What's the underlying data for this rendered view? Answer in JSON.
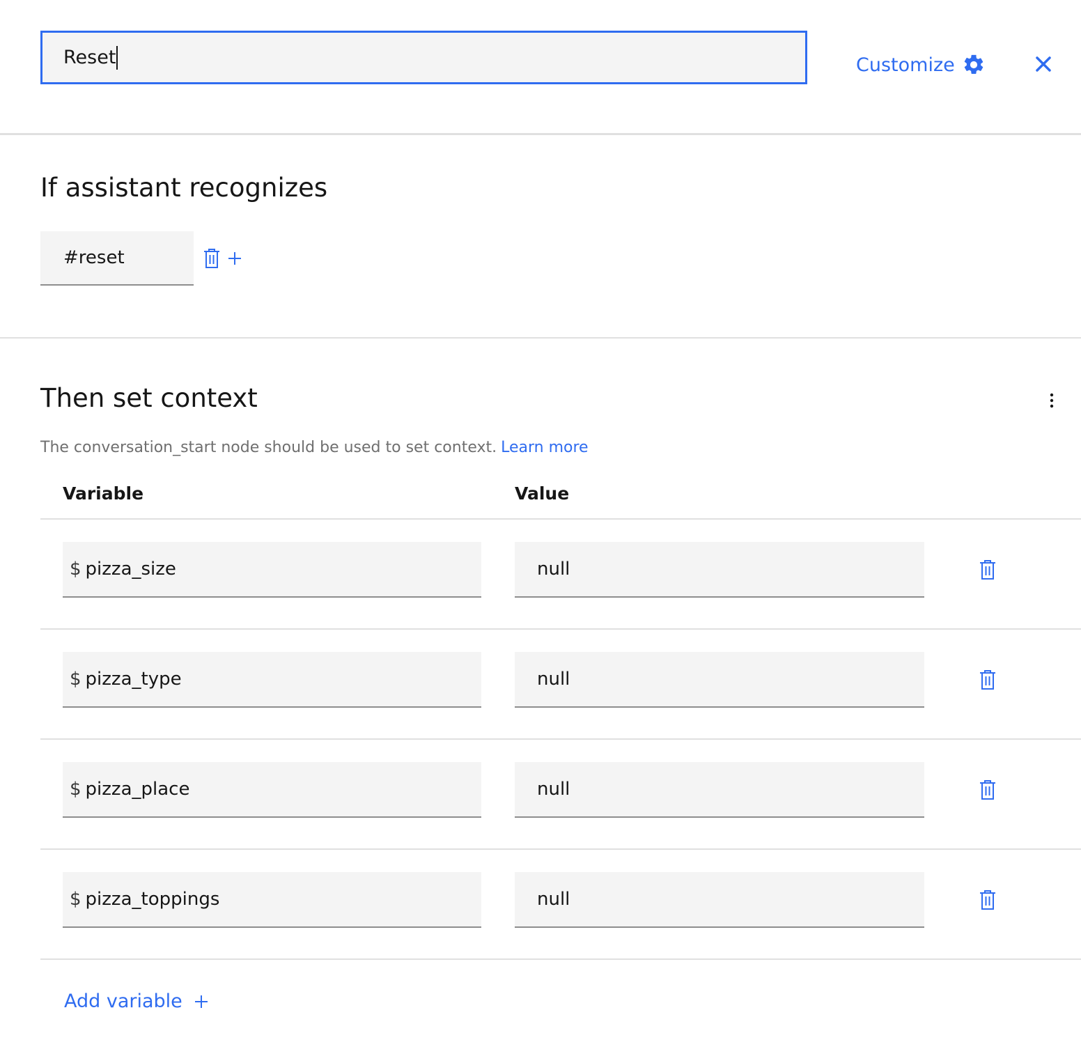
{
  "node": {
    "name_value": "Reset",
    "customize_label": "Customize",
    "customize_icon": "gear-icon",
    "close_icon": "close-icon"
  },
  "conditions": {
    "title": "If assistant recognizes",
    "items": [
      {
        "label": "#reset",
        "icon": "trash-icon"
      }
    ],
    "add_icon": "plus-icon"
  },
  "context": {
    "title": "Then set context",
    "overflow_icon": "overflow-menu-icon",
    "helper_text": "The conversation_start node should be used to set context.",
    "learn_more_label": "Learn more",
    "column_variable": "Variable",
    "column_value": "Value",
    "rows": [
      {
        "prefix": "$",
        "variable": "pizza_size",
        "value": "null"
      },
      {
        "prefix": "$",
        "variable": "pizza_type",
        "value": "null"
      },
      {
        "prefix": "$",
        "variable": "pizza_place",
        "value": "null"
      },
      {
        "prefix": "$",
        "variable": "pizza_toppings",
        "value": "null"
      }
    ],
    "add_variable_label": "Add variable"
  },
  "colors": {
    "accent": "#2f6cf0",
    "field_bg": "#f4f4f4",
    "divider": "#e0e0e0",
    "helper_text": "#6f6f6f"
  }
}
